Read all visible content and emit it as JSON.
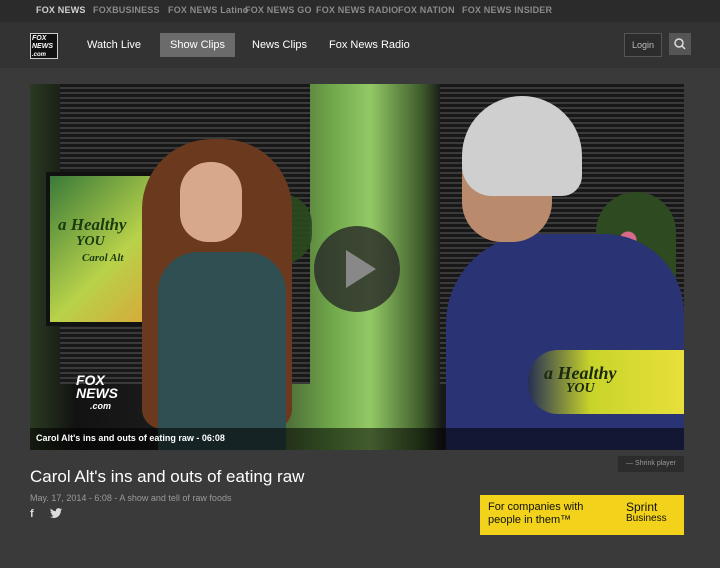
{
  "network_links": [
    {
      "label": "FOX NEWS",
      "active": true
    },
    {
      "label": "FOXBUSINESS"
    },
    {
      "label": "FOX NEWS Latino"
    },
    {
      "label": "FOX NEWS GO"
    },
    {
      "label": "FOX NEWS RADIO"
    },
    {
      "label": "FOX NATION"
    },
    {
      "label": "FOX NEWS INSIDER"
    }
  ],
  "logo": {
    "line1": "FOX",
    "line2": "NEWS",
    "line3": ".com"
  },
  "nav": {
    "items": [
      {
        "label": "Watch Live"
      },
      {
        "label": "Show Clips",
        "active": true
      },
      {
        "label": "News Clips"
      },
      {
        "label": "Fox News Radio"
      }
    ],
    "login": "Login"
  },
  "video": {
    "caption": "Carol Alt's ins and outs of eating raw - 06:08",
    "tv_text": {
      "line1": "a Healthy",
      "line2": "YOU",
      "line3": "Carol Alt"
    },
    "lower_third": {
      "line1": "a Healthy",
      "line2": "YOU"
    },
    "bug": {
      "line1": "FOX",
      "line2": "NEWS",
      "line3": ".com"
    }
  },
  "player": {
    "shrink_label": "— Shrink player"
  },
  "clip": {
    "title": "Carol Alt's ins and outs of eating raw",
    "meta": "May. 17, 2014 - 6:08 - A show and tell of raw foods"
  },
  "social": {
    "facebook": "f",
    "twitter": "t"
  },
  "ad": {
    "text_line1": "For companies with",
    "text_line2": "people in them™",
    "brand_line1": "Sprint",
    "brand_line2": "Business",
    "bg_color": "#f2d21a"
  },
  "colors": {
    "page_bg": "#3a3a3a",
    "nav_active": "#6b6b6b"
  }
}
